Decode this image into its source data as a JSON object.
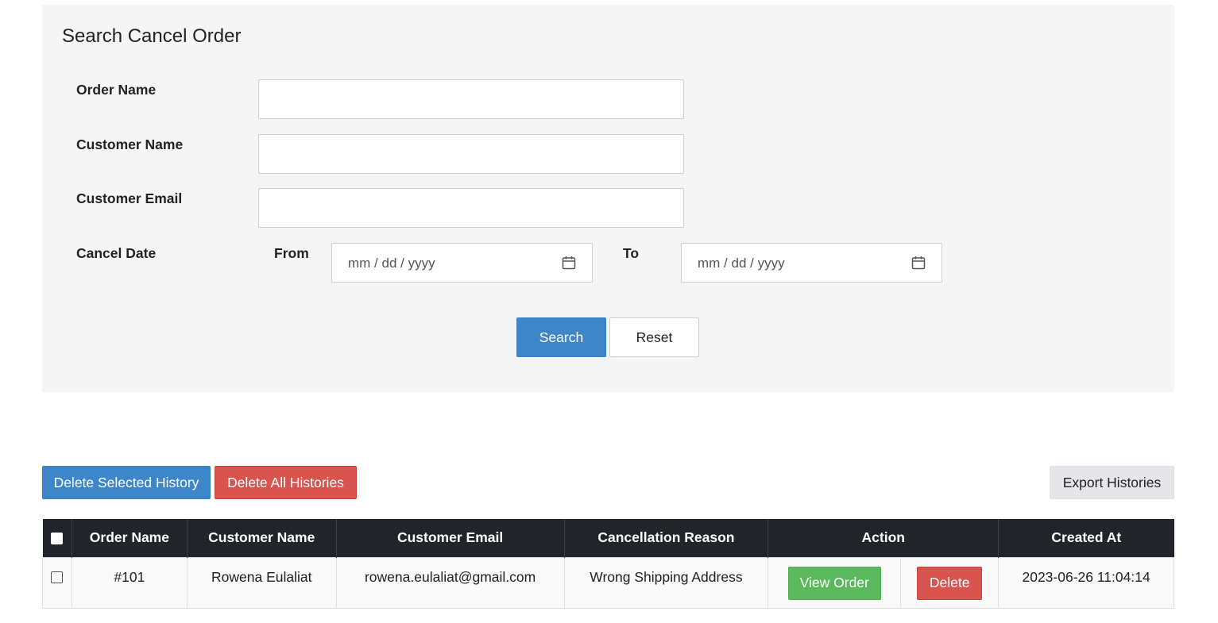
{
  "search_panel": {
    "title": "Search Cancel Order",
    "order_name_label": "Order Name",
    "order_name_value": "",
    "customer_name_label": "Customer Name",
    "customer_name_value": "",
    "customer_email_label": "Customer Email",
    "customer_email_value": "",
    "cancel_date_label": "Cancel Date",
    "from_label": "From",
    "to_label": "To",
    "date_placeholder": "mm / dd / yyyy",
    "search_button": "Search",
    "reset_button": "Reset"
  },
  "toolbar": {
    "delete_selected": "Delete Selected History",
    "delete_all": "Delete All Histories",
    "export": "Export Histories"
  },
  "table": {
    "headers": [
      "Order Name",
      "Customer Name",
      "Customer Email",
      "Cancellation Reason",
      "Action",
      "Created At"
    ],
    "rows": [
      {
        "order_name": "#101",
        "customer_name": "Rowena Eulaliat",
        "customer_email": "rowena.eulaliat@gmail.com",
        "reason": "Wrong Shipping Address",
        "view_label": "View Order",
        "delete_label": "Delete",
        "created_at": "2023-06-26 11:04:14"
      }
    ]
  },
  "colors": {
    "primary": "#3d86c9",
    "danger": "#d9534f",
    "success": "#5cb85c",
    "table_header": "#212529",
    "panel_bg": "#f5f5f5"
  }
}
